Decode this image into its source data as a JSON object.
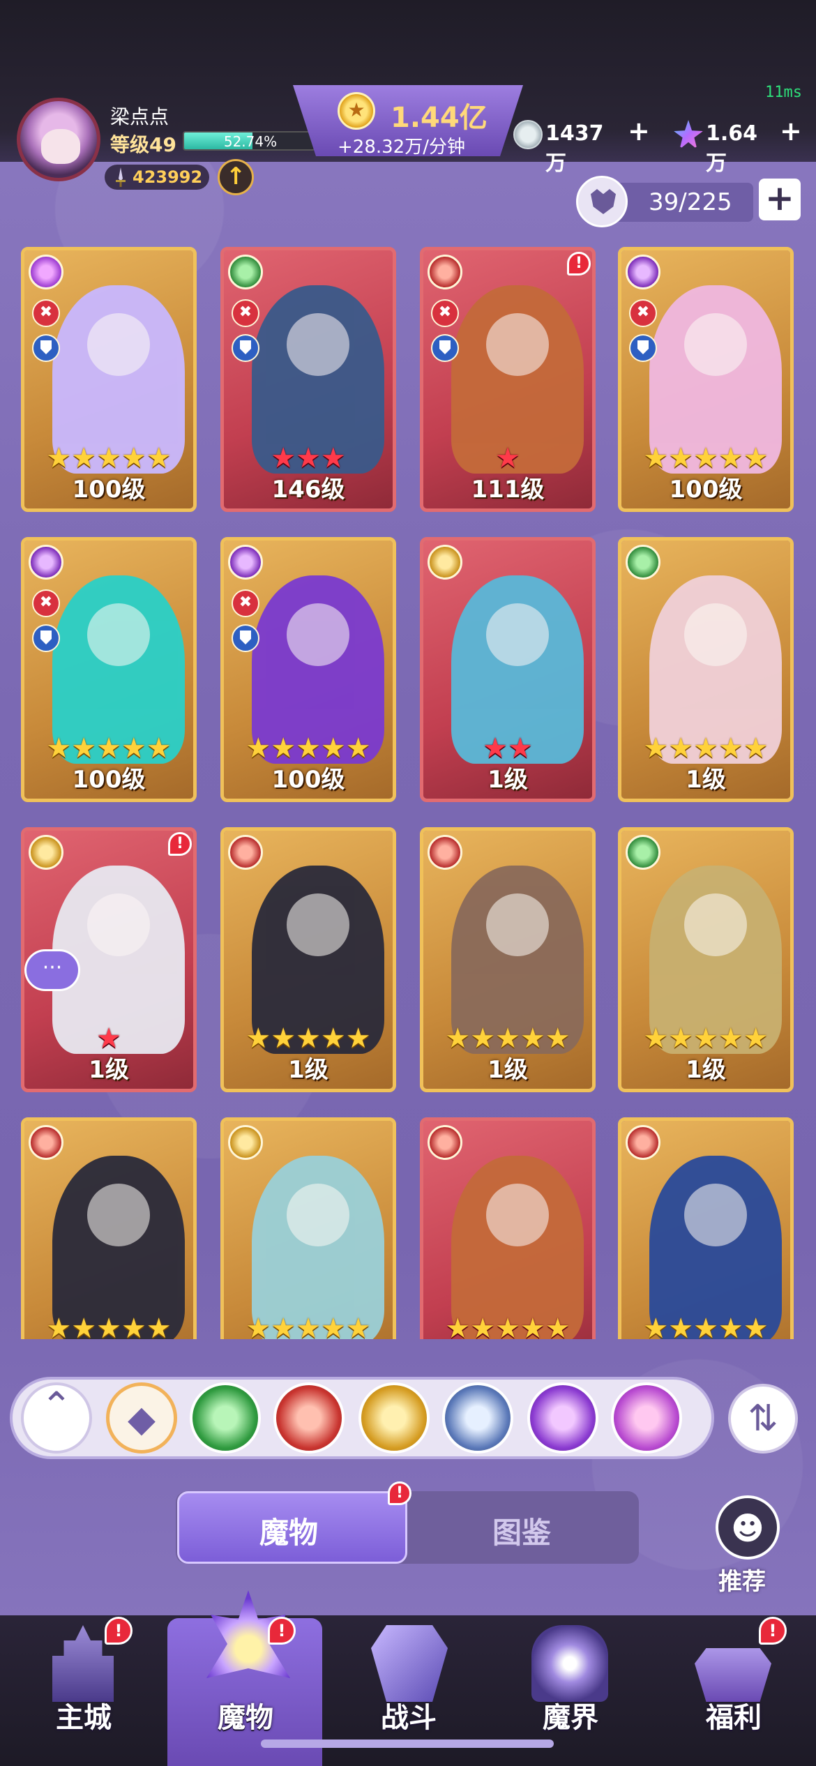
{
  "header": {
    "ping": "11ms",
    "player_name": "梁点点",
    "level_label": "等级49",
    "exp_percent_text": "52.74%",
    "exp_fraction": 0.5274,
    "power": "423992",
    "gold_amount": "1.44亿",
    "gold_rate": "+28.32万/分钟",
    "resource1": "1437万",
    "resource2": "1.64万",
    "plus_symbol": "+",
    "capacity": "39/225"
  },
  "cards": [
    {
      "faction": "arcane",
      "stars": 5,
      "star_color": "gold",
      "level": "100级",
      "frame": "gold",
      "alert": false,
      "figure_color": "#c9b8ff"
    },
    {
      "faction": "nature",
      "stars": 3,
      "star_color": "red",
      "level": "146级",
      "frame": "red",
      "alert": false,
      "figure_color": "#3a5a8a"
    },
    {
      "faction": "demon",
      "stars": 1,
      "star_color": "red",
      "level": "111级",
      "frame": "red",
      "alert": true,
      "figure_color": "#c46a3a"
    },
    {
      "faction": "eye",
      "stars": 5,
      "star_color": "gold",
      "level": "100级",
      "frame": "gold",
      "alert": false,
      "figure_color": "#f0b8e0"
    },
    {
      "faction": "eye",
      "stars": 5,
      "star_color": "gold",
      "level": "100级",
      "frame": "gold",
      "alert": false,
      "figure_color": "#2ad0c8"
    },
    {
      "faction": "eye",
      "stars": 5,
      "star_color": "gold",
      "level": "100级",
      "frame": "gold",
      "alert": false,
      "figure_color": "#7a3ad0"
    },
    {
      "faction": "time",
      "stars": 2,
      "star_color": "red",
      "level": "1级",
      "frame": "red",
      "alert": false,
      "figure_color": "#5ab8d8"
    },
    {
      "faction": "nature",
      "stars": 5,
      "star_color": "gold",
      "level": "1级",
      "frame": "gold",
      "alert": false,
      "figure_color": "#f0d0d8"
    },
    {
      "faction": "time",
      "stars": 1,
      "star_color": "red",
      "level": "1级",
      "frame": "red",
      "alert": true,
      "figure_color": "#e8e8f0"
    },
    {
      "faction": "demon",
      "stars": 5,
      "star_color": "gold",
      "level": "1级",
      "frame": "gold",
      "alert": false,
      "figure_color": "#2a2a3a"
    },
    {
      "faction": "demon",
      "stars": 5,
      "star_color": "gold",
      "level": "1级",
      "frame": "gold",
      "alert": false,
      "figure_color": "#8a6a5a"
    },
    {
      "faction": "nature",
      "stars": 5,
      "star_color": "gold",
      "level": "1级",
      "frame": "gold",
      "alert": false,
      "figure_color": "#c8b070"
    },
    {
      "faction": "demon",
      "stars": 5,
      "star_color": "gold",
      "level": "",
      "frame": "gold",
      "alert": false,
      "figure_color": "#2a2a3a"
    },
    {
      "faction": "time",
      "stars": 5,
      "star_color": "gold",
      "level": "",
      "frame": "gold",
      "alert": false,
      "figure_color": "#9ad0d8"
    },
    {
      "faction": "demon",
      "stars": 5,
      "star_color": "gold",
      "level": "",
      "frame": "red",
      "alert": false,
      "figure_color": "#c46a3a"
    },
    {
      "faction": "demon",
      "stars": 5,
      "star_color": "gold",
      "level": "",
      "frame": "gold",
      "alert": false,
      "figure_color": "#2a4a9a"
    }
  ],
  "chat_bubble": "···",
  "alert_mark": "!",
  "filters": [
    "collapse",
    "all",
    "nature",
    "demon",
    "time",
    "dragon",
    "eye",
    "arcane"
  ],
  "tabs": {
    "active": "魔物",
    "inactive": "图鉴"
  },
  "recommend_label": "推荐",
  "nav": [
    {
      "label": "主城",
      "icon": "castle-icon",
      "alert": true
    },
    {
      "label": "魔物",
      "icon": "monster-icon",
      "alert": true,
      "active": true
    },
    {
      "label": "战斗",
      "icon": "battle-icon",
      "alert": false
    },
    {
      "label": "魔界",
      "icon": "realm-icon",
      "alert": false
    },
    {
      "label": "福利",
      "icon": "welfare-icon",
      "alert": true
    }
  ]
}
